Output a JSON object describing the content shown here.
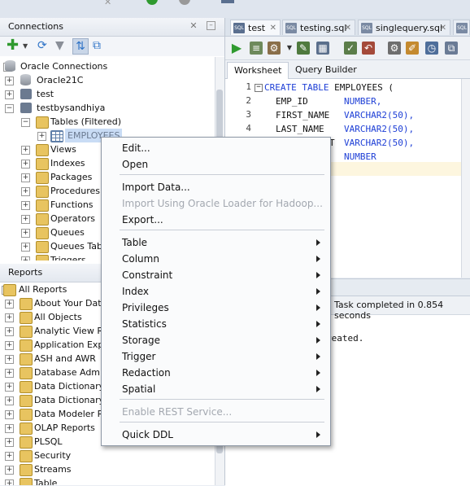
{
  "connections_panel": {
    "title": "Connections",
    "tree": [
      {
        "label": "Oracle Connections"
      },
      {
        "label": "Oracle21C"
      },
      {
        "label": "test"
      },
      {
        "label": "testbysandhiya"
      },
      {
        "label": "Tables (Filtered)"
      },
      {
        "label": "EMPLOYEES"
      },
      {
        "label": "Views"
      },
      {
        "label": "Indexes"
      },
      {
        "label": "Packages"
      },
      {
        "label": "Procedures"
      },
      {
        "label": "Functions"
      },
      {
        "label": "Operators"
      },
      {
        "label": "Queues"
      },
      {
        "label": "Queues Tabl"
      },
      {
        "label": "Triggers"
      }
    ]
  },
  "reports_panel": {
    "title": "Reports",
    "tree": [
      {
        "label": "All Reports"
      },
      {
        "label": "About Your Data"
      },
      {
        "label": "All Objects"
      },
      {
        "label": "Analytic View Rep"
      },
      {
        "label": "Application Expre"
      },
      {
        "label": "ASH and AWR"
      },
      {
        "label": "Database Admini"
      },
      {
        "label": "Data Dictionary"
      },
      {
        "label": "Data Dictionary R"
      },
      {
        "label": "Data Modeler Re"
      },
      {
        "label": "OLAP Reports"
      },
      {
        "label": "PLSQL"
      },
      {
        "label": "Security"
      },
      {
        "label": "Streams"
      },
      {
        "label": "Table"
      }
    ]
  },
  "editor_tabs": [
    {
      "label": "test"
    },
    {
      "label": "testing.sql"
    },
    {
      "label": "singlequery.sql"
    }
  ],
  "worksheet_tabs": {
    "worksheet": "Worksheet",
    "query_builder": "Query Builder"
  },
  "code": {
    "line_numbers": [
      "1",
      "2",
      "3",
      "4",
      "5",
      "6"
    ],
    "line1": {
      "kw": "CREATE TABLE",
      "rest": " EMPLOYEES ("
    },
    "line2": {
      "name": "EMP_ID",
      "type": "NUMBER,"
    },
    "line3": {
      "name": "FIRST_NAME",
      "type": "VARCHAR2(50),"
    },
    "line4": {
      "name": "LAST_NAME",
      "type": "VARCHAR2(50),"
    },
    "line5": {
      "name": "T",
      "type": "VARCHAR2(50),"
    },
    "line6": {
      "type": "NUMBER"
    }
  },
  "output": {
    "status": "Task completed in 0.854 seconds",
    "message": "reated."
  },
  "context_menu": {
    "edit": "Edit...",
    "open": "Open",
    "import_data": "Import Data...",
    "import_loader": "Import Using Oracle Loader for Hadoop...",
    "export": "Export...",
    "table": "Table",
    "column": "Column",
    "constraint": "Constraint",
    "index": "Index",
    "privileges": "Privileges",
    "statistics": "Statistics",
    "storage": "Storage",
    "trigger": "Trigger",
    "redaction": "Redaction",
    "spatial": "Spatial",
    "enable_rest": "Enable REST Service...",
    "quick_ddl": "Quick DDL"
  },
  "colors": {
    "keyword": "#1e3fd6",
    "run_green": "#2f9a2f",
    "folder": "#e8c460",
    "selection": "#c9dcf5"
  }
}
